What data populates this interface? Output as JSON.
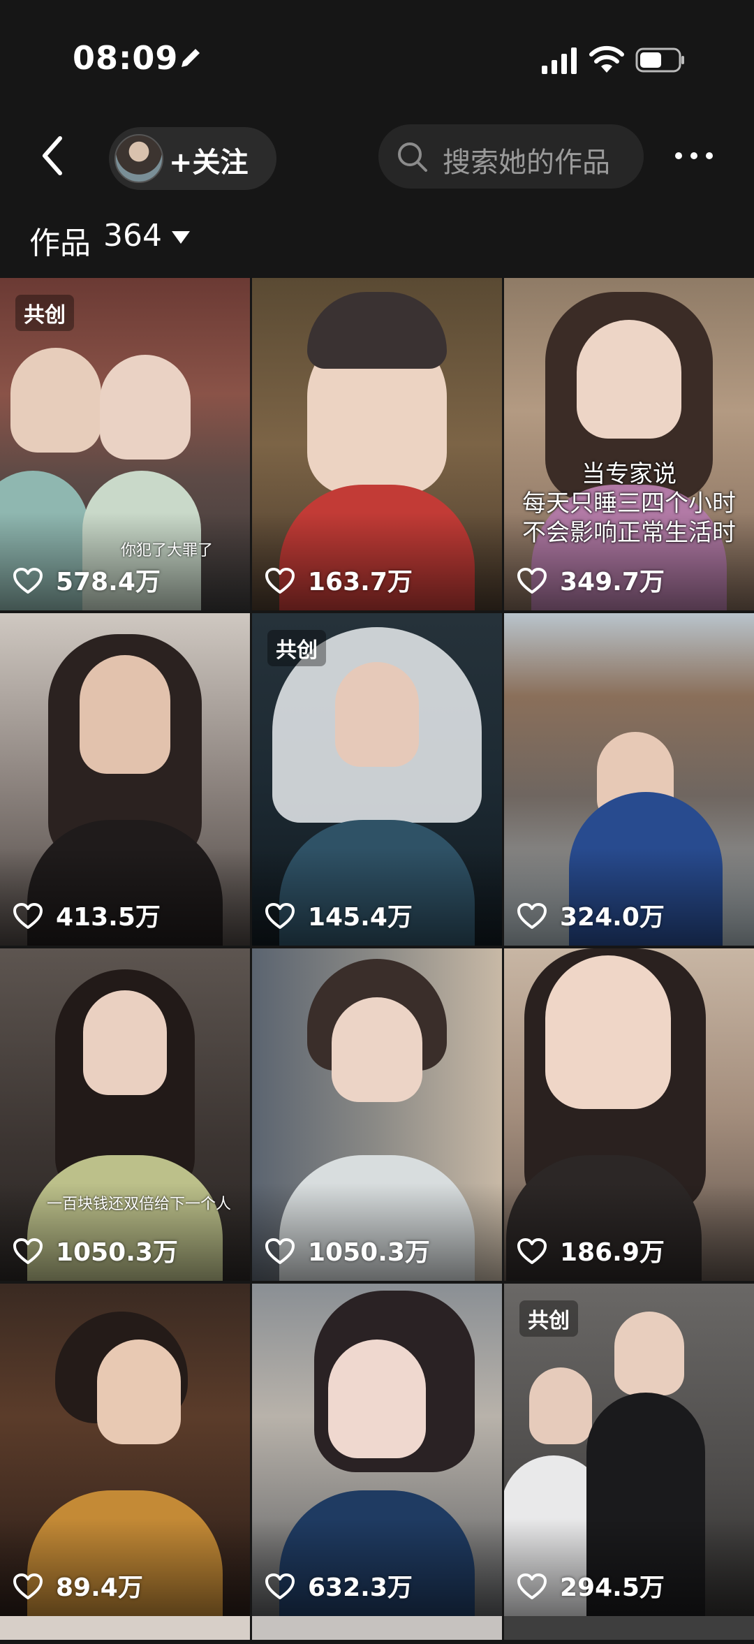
{
  "status": {
    "time": "08:09"
  },
  "nav": {
    "follow_label": "+关注",
    "search_placeholder": "搜索她的作品"
  },
  "works": {
    "label": "作品",
    "count": "364"
  },
  "tiles": [
    {
      "likes": "578.4万",
      "badge": "共创",
      "caption": "你犯了大罪了"
    },
    {
      "likes": "163.7万"
    },
    {
      "likes": "349.7万",
      "overlay": [
        "当专家说",
        "每天只睡三四个小时",
        "不会影响正常生活时"
      ]
    },
    {
      "likes": "413.5万"
    },
    {
      "likes": "145.4万",
      "badge": "共创"
    },
    {
      "likes": "324.0万"
    },
    {
      "likes": "1050.3万",
      "caption": "一百块钱还双倍给下一个人"
    },
    {
      "likes": "1050.3万"
    },
    {
      "likes": "186.9万"
    },
    {
      "likes": "89.4万"
    },
    {
      "likes": "632.3万"
    },
    {
      "likes": "294.5万",
      "badge": "共创"
    }
  ],
  "icons": {
    "back": "back-arrow-icon",
    "search": "search-icon",
    "more": "more-icon",
    "like": "heart-icon"
  }
}
